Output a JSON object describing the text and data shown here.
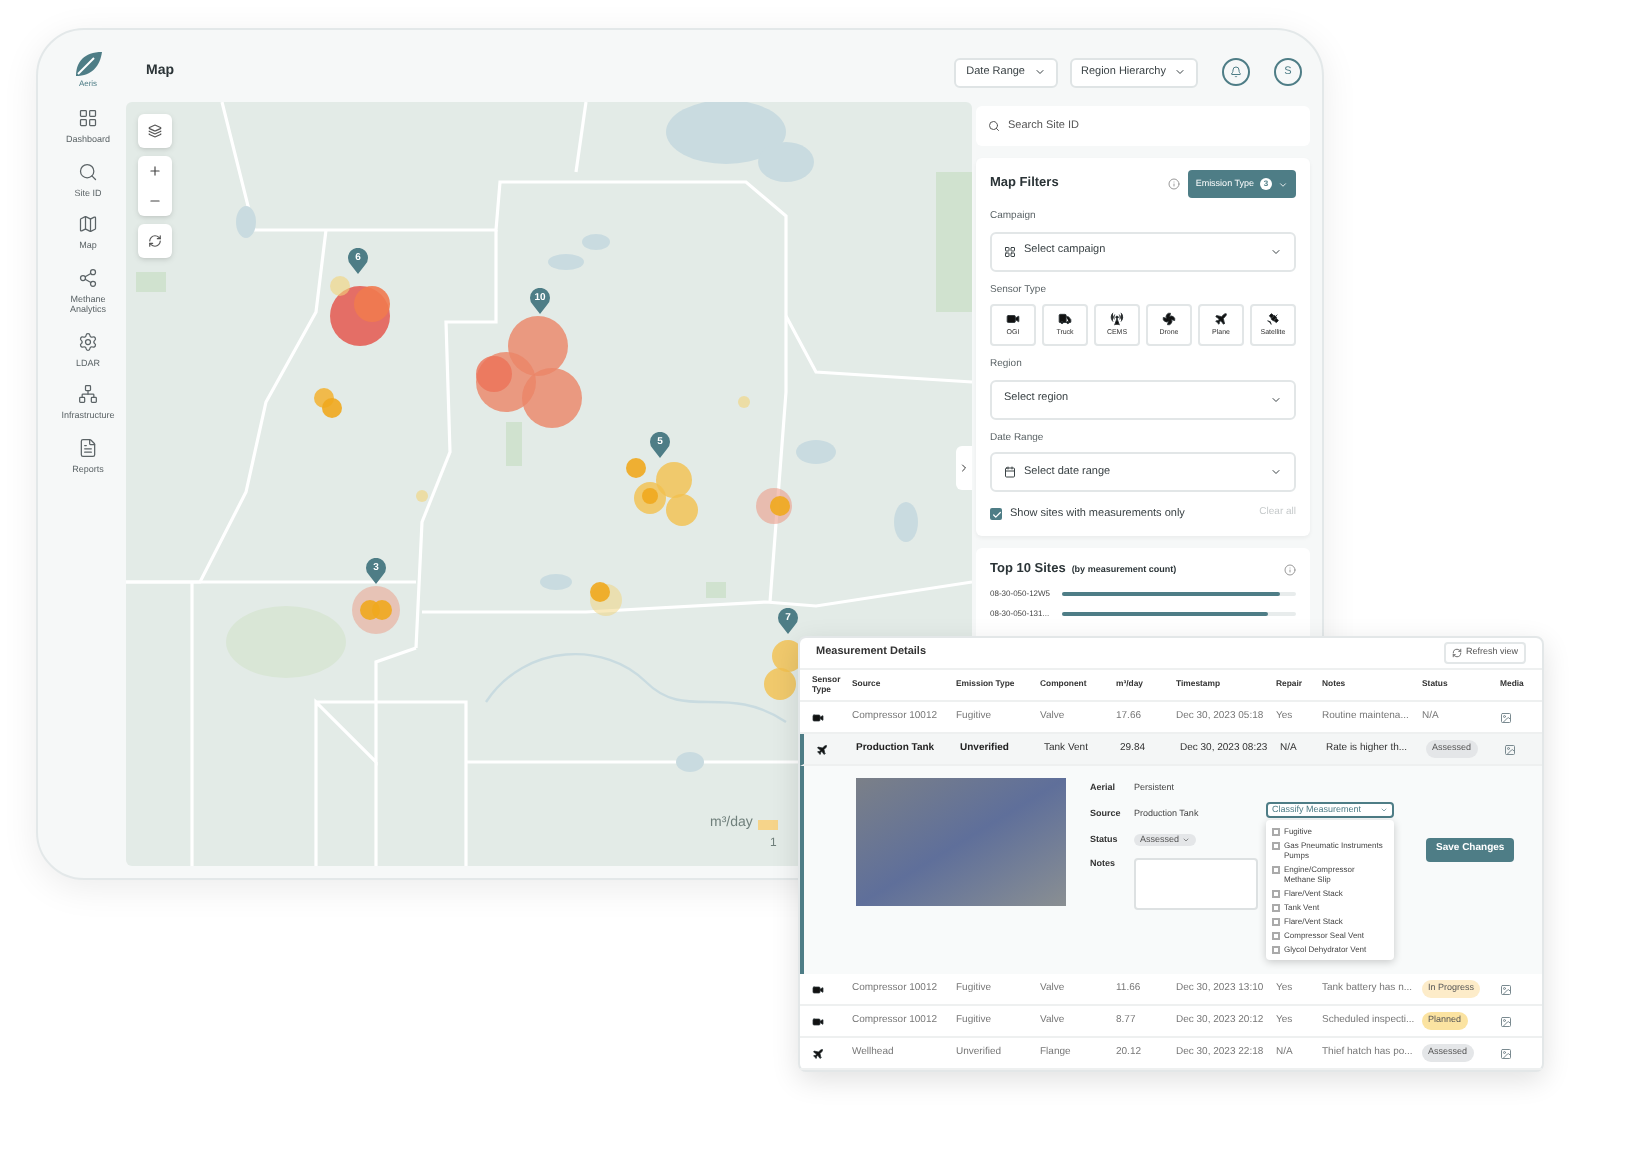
{
  "logo": {
    "text": "Aeris"
  },
  "sidebar": {
    "items": [
      {
        "label": "Dashboard"
      },
      {
        "label": "Site ID"
      },
      {
        "label": "Map"
      },
      {
        "label": "Methane Analytics"
      },
      {
        "label": "LDAR"
      },
      {
        "label": "Infrastructure"
      },
      {
        "label": "Reports"
      }
    ]
  },
  "header": {
    "title": "Map",
    "dropdowns": [
      "Date Range",
      "Region Hierarchy"
    ],
    "avatar": "S"
  },
  "map": {
    "clusters": [
      {
        "count": "6"
      },
      {
        "count": "10"
      },
      {
        "count": "5"
      },
      {
        "count": "3"
      },
      {
        "count": "7"
      }
    ],
    "legend": {
      "unit": "m³/day",
      "tick": "1"
    }
  },
  "search": {
    "placeholder": "Search Site ID"
  },
  "filters": {
    "title": "Map Filters",
    "emission_type": {
      "label": "Emission Type",
      "count": "3"
    },
    "campaign": {
      "label": "Campaign",
      "placeholder": "Select campaign"
    },
    "sensor_type": {
      "label": "Sensor Type",
      "options": [
        {
          "kind": "ogi",
          "label": "OGI"
        },
        {
          "kind": "truck",
          "label": "Truck"
        },
        {
          "kind": "cems",
          "label": "CEMS"
        },
        {
          "kind": "drone",
          "label": "Drone"
        },
        {
          "kind": "plane",
          "label": "Plane"
        },
        {
          "kind": "satellite",
          "label": "Satellite"
        }
      ]
    },
    "region": {
      "label": "Region",
      "placeholder": "Select region"
    },
    "date_range": {
      "label": "Date Range",
      "placeholder": "Select date range"
    },
    "measurements_only": {
      "label": "Show sites with measurements only",
      "checked": true
    },
    "clear": "Clear all"
  },
  "top_sites": {
    "title": "Top 10 Sites",
    "subtitle": "(by measurement count)",
    "items": [
      {
        "label": "08-30-050-12W5",
        "level": 0.93
      },
      {
        "label": "08-30-050-131...",
        "level": 0.88
      }
    ]
  },
  "measurements": {
    "title": "Measurement Details",
    "refresh": "Refresh view",
    "columns": [
      "Sensor Type",
      "Source",
      "Emission Type",
      "Component",
      "m³/day",
      "Timestamp",
      "Repair",
      "Notes",
      "Status",
      "Media"
    ],
    "rows": [
      {
        "kind": "ogi",
        "expanded": false,
        "cells": [
          "",
          "Compressor 10012",
          "Fugitive",
          "Valve",
          "17.66",
          "Dec 30, 2023 05:18",
          "Yes",
          "Routine maintena..."
        ],
        "status": {
          "text": "N/A"
        }
      },
      {
        "kind": "plane",
        "expanded": true,
        "cells": [
          "",
          "Production Tank",
          "Unverified",
          "Tank Vent",
          "29.84",
          "Dec 30, 2023 08:23",
          "N/A",
          "Rate is higher th..."
        ],
        "status": {
          "text": "Assessed",
          "color": "#e4e6e8"
        },
        "detail": {
          "fields": [
            {
              "label": "Aerial",
              "value": "Persistent"
            },
            {
              "label": "Source",
              "value": "Production Tank"
            },
            {
              "label": "Status",
              "value": "Assessed"
            },
            {
              "label": "Notes"
            }
          ],
          "classify": {
            "label": "Classify Measurement",
            "options": [
              {
                "label": "Fugitive",
                "checked": false
              },
              {
                "label": "Gas Pneumatic Instruments Pumps",
                "checked": false
              },
              {
                "label": "Engine/Compressor Methane Slip",
                "checked": false
              },
              {
                "label": "Flare/Vent Stack",
                "checked": false
              },
              {
                "label": "Tank Vent",
                "checked": false
              },
              {
                "label": "Flare/Vent Stack",
                "checked": false
              },
              {
                "label": "Compressor Seal Vent",
                "checked": false
              },
              {
                "label": "Glycol Dehydrator Vent",
                "checked": false
              }
            ]
          },
          "save": "Save Changes"
        }
      },
      {
        "kind": "ogi",
        "expanded": false,
        "cells": [
          "",
          "Compressor 10012",
          "Fugitive",
          "Valve",
          "11.66",
          "Dec 30, 2023 13:10",
          "Yes",
          "Tank battery has n..."
        ],
        "status": {
          "text": "In Progress",
          "color": "#fdecc9"
        }
      },
      {
        "kind": "ogi",
        "expanded": false,
        "cells": [
          "",
          "Compressor 10012",
          "Fugitive",
          "Valve",
          "8.77",
          "Dec 30, 2023 20:12",
          "Yes",
          "Scheduled inspecti..."
        ],
        "status": {
          "text": "Planned",
          "color": "#fbe3a1"
        }
      },
      {
        "kind": "plane",
        "expanded": false,
        "cells": [
          "",
          "Wellhead",
          "Unverified",
          "Flange",
          "20.12",
          "Dec 30, 2023 22:18",
          "N/A",
          "Thief hatch has po..."
        ],
        "status": {
          "text": "Assessed",
          "color": "#e4e6e8"
        }
      }
    ]
  }
}
